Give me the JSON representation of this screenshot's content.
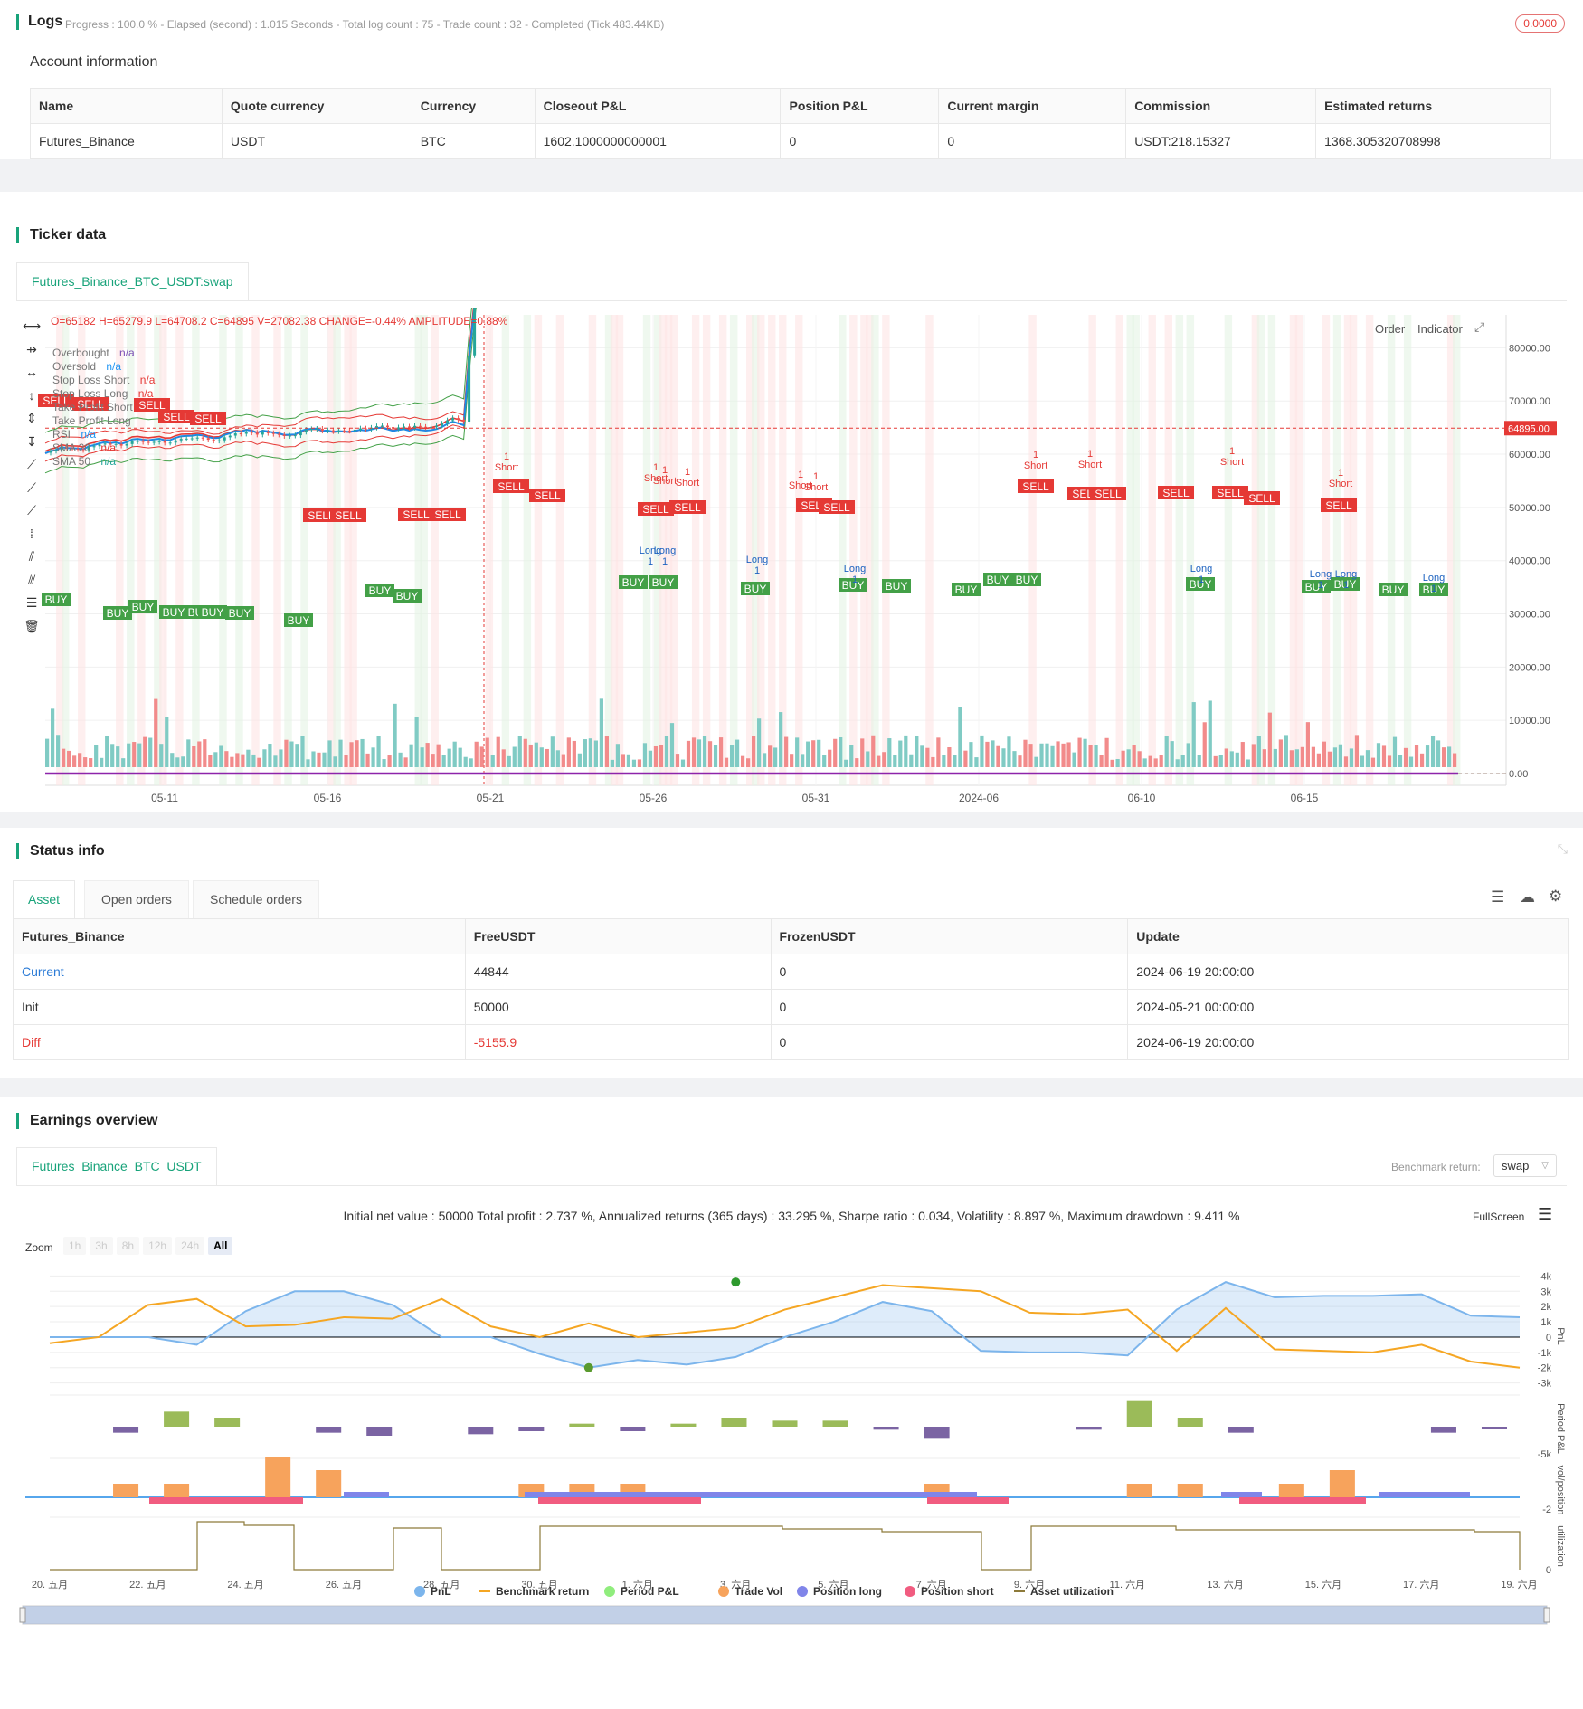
{
  "logs": {
    "title": "Logs",
    "progress": "Progress : 100.0 % - Elapsed (second) : 1.015  Seconds - Total log count : 75 - Trade count : 32 - Completed (Tick 483.44KB)",
    "badge": "0.0000"
  },
  "account": {
    "title": "Account information",
    "headers": [
      "Name",
      "Quote currency",
      "Currency",
      "Closeout P&L",
      "Position P&L",
      "Current margin",
      "Commission",
      "Estimated returns"
    ],
    "row": [
      "Futures_Binance",
      "USDT",
      "BTC",
      "1602.1000000000001",
      "0",
      "0",
      "USDT:218.15327",
      "1368.305320708998"
    ]
  },
  "ticker": {
    "title": "Ticker data",
    "tab": "Futures_Binance_BTC_USDT:swap",
    "ohlc": "O=65182 H=65279.9 L=64708.2 C=64895 V=27082.38 CHANGE=-0.44% AMPLITUDE=0.88%",
    "btn_order": "Order",
    "btn_indicator": "Indicator",
    "legend": [
      {
        "name": "Overbought",
        "val": "n/a",
        "color": "#7b4fb5"
      },
      {
        "name": "Oversold",
        "val": "n/a",
        "color": "#2196f3"
      },
      {
        "name": "Stop Loss Short",
        "val": "n/a",
        "color": "#e53935"
      },
      {
        "name": "Stop Loss Long",
        "val": "n/a",
        "color": "#e53935"
      },
      {
        "name": "Take Profit Short",
        "val": "",
        "color": "#43a047"
      },
      {
        "name": "Take Profit Long",
        "val": "",
        "color": "#43a047"
      },
      {
        "name": "RSI",
        "val": "n/a",
        "color": "#2196f3"
      },
      {
        "name": "SMA 20",
        "val": "n/a",
        "color": "#e53935"
      },
      {
        "name": "SMA 50",
        "val": "n/a",
        "color": "#26a69a"
      }
    ],
    "price_label": "64895.00",
    "x_ticks": [
      "05-11",
      "05-16",
      "05-21",
      "05-26",
      "05-31",
      "2024-06",
      "06-10",
      "06-15"
    ],
    "y_ticks": [
      "80000.00",
      "70000.00",
      "60000.00",
      "50000.00",
      "40000.00",
      "30000.00",
      "20000.00",
      "10000.00",
      "0.00"
    ],
    "marker_buy": "BUY",
    "marker_sell": "SELL",
    "marker_long": "Long",
    "marker_short": "Short",
    "marker_qty": "1"
  },
  "status": {
    "title": "Status info",
    "tabs": [
      "Asset",
      "Open orders",
      "Schedule orders"
    ],
    "headers": [
      "Futures_Binance",
      "FreeUSDT",
      "FrozenUSDT",
      "Update"
    ],
    "rows": [
      [
        "Current",
        "44844",
        "0",
        "2024-06-19 20:00:00"
      ],
      [
        "Init",
        "50000",
        "0",
        "2024-05-21 00:00:00"
      ],
      [
        "Diff",
        "-5155.9",
        "0",
        "2024-06-19 20:00:00"
      ]
    ]
  },
  "earnings": {
    "title": "Earnings overview",
    "tab": "Futures_Binance_BTC_USDT",
    "bench_label": "Benchmark return:",
    "bench_value": "swap",
    "summary": "Initial net value : 50000 Total profit : 2.737 %, Annualized returns (365 days) : 33.295 %, Sharpe ratio : 0.034, Volatility : 8.897 %, Maximum drawdown : 9.411 %",
    "fullscreen": "FullScreen",
    "zoom_label": "Zoom",
    "zoom": [
      "1h",
      "3h",
      "8h",
      "12h",
      "24h",
      "All"
    ],
    "y_pnl": [
      "4k",
      "3k",
      "2k",
      "1k",
      "0",
      "-1k",
      "-2k",
      "-3k"
    ],
    "y_period": [
      "-5k"
    ],
    "y_vol": [
      "-2"
    ],
    "y_util": [
      "0"
    ],
    "axis_titles": [
      "PnL",
      "Period P&L",
      "vol/position",
      "utilization"
    ],
    "x_ticks": [
      "20. 五月",
      "22. 五月",
      "24. 五月",
      "26. 五月",
      "28. 五月",
      "30. 五月",
      "1. 六月",
      "3. 六月",
      "5. 六月",
      "7. 六月",
      "9. 六月",
      "11. 六月",
      "13. 六月",
      "15. 六月",
      "17. 六月",
      "19. 六月"
    ],
    "legend": [
      {
        "name": "PnL",
        "color": "#7cb5ec"
      },
      {
        "name": "Benchmark return",
        "color": "#f5a623"
      },
      {
        "name": "Period P&L",
        "color": "#90ed7d"
      },
      {
        "name": "Trade Vol",
        "color": "#f7a35c"
      },
      {
        "name": "Position long",
        "color": "#8085e9"
      },
      {
        "name": "Position short",
        "color": "#f15c80"
      },
      {
        "name": "Asset utilization",
        "color": "#8d7a3a"
      }
    ]
  },
  "chart_data": [
    {
      "type": "line",
      "name": "PnL",
      "x": [
        "05-20",
        "05-21",
        "05-22",
        "05-23",
        "05-24",
        "05-25",
        "05-26",
        "05-27",
        "05-28",
        "05-29",
        "05-30",
        "05-31",
        "06-01",
        "06-02",
        "06-03",
        "06-04",
        "06-05",
        "06-06",
        "06-07",
        "06-08",
        "06-09",
        "06-10",
        "06-11",
        "06-12",
        "06-13",
        "06-14",
        "06-15",
        "06-16",
        "06-17",
        "06-18",
        "06-19"
      ],
      "values": [
        0,
        0,
        0,
        -500,
        1700,
        3000,
        3000,
        2100,
        0,
        0,
        -1100,
        -2000,
        -1500,
        -1800,
        -1300,
        0,
        1000,
        2300,
        1700,
        -900,
        -1000,
        -1000,
        -1200,
        1800,
        3600,
        2600,
        2700,
        2700,
        2800,
        1400,
        1300
      ]
    },
    {
      "type": "line",
      "name": "Benchmark return",
      "values": [
        -400,
        0,
        2100,
        2500,
        700,
        800,
        1300,
        1200,
        2500,
        700,
        0,
        900,
        0,
        300,
        600,
        1800,
        2600,
        3400,
        3200,
        3000,
        1600,
        1500,
        1800,
        -900,
        1900,
        -800,
        -900,
        -1000,
        -500,
        -1600,
        -2000
      ]
    },
    {
      "type": "bar",
      "name": "Period P&L",
      "values": [
        0,
        -400,
        1000,
        600,
        0,
        -400,
        -600,
        0,
        -500,
        -300,
        200,
        -300,
        200,
        600,
        400,
        400,
        -200,
        -800,
        0,
        0,
        -200,
        1700,
        600,
        -400,
        0,
        0,
        0,
        -400,
        -100
      ]
    },
    {
      "type": "bar",
      "name": "Trade Vol",
      "values": [
        0,
        1,
        1,
        0,
        3,
        2,
        0,
        0,
        0,
        1,
        1,
        1,
        0,
        0,
        0,
        0,
        0,
        1,
        0,
        0,
        0,
        1,
        1,
        0,
        1,
        2,
        0,
        0,
        0
      ]
    }
  ]
}
